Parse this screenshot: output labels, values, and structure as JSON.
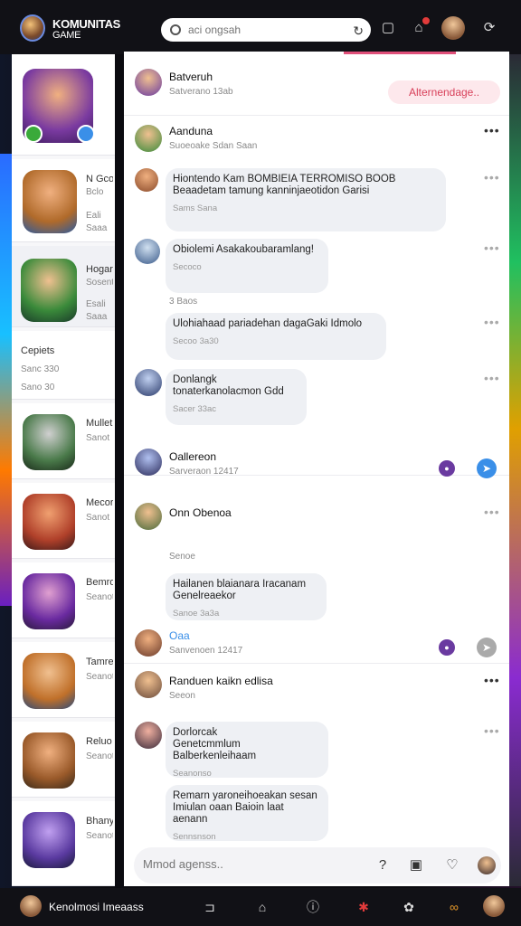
{
  "colors": {
    "accent": "#d8405a",
    "send_blue": "#3a8fe8",
    "badge": "#e23b3b"
  },
  "header": {
    "brand_title": "KOMUNITAS",
    "brand_subtitle": "GAME",
    "search_placeholder": "aci ongsah"
  },
  "left_cards": [
    {
      "name": "",
      "meta": ""
    },
    {
      "name": "N Gcoa",
      "meta": "Bclo",
      "stat1": "Eali",
      "stat2": "Saaa"
    },
    {
      "name": "Hogar",
      "meta": "Sosent",
      "stat1": "Esali",
      "stat2": "Saaa"
    },
    {
      "name": "Cepiets",
      "meta": "",
      "stat1": "Sanc 330",
      "stat2": "Sano 30"
    },
    {
      "name": "Mullet",
      "meta": "Sanot"
    },
    {
      "name": "Mecor",
      "meta": "Sanot"
    },
    {
      "name": "Bemro",
      "meta": "Seanot"
    },
    {
      "name": "Tamre",
      "meta": "Seanot"
    },
    {
      "name": "Reluo",
      "meta": "Seanot"
    },
    {
      "name": "Bhanyo",
      "meta": "Seanot"
    }
  ],
  "posts": [
    {
      "name": "Batveruh",
      "meta": "Satverano 13ab",
      "cta": "Alternendage.."
    },
    {
      "name": "Aanduna",
      "meta": "Suoeoake  Sdan  Saan",
      "text": "Hiontendo Kam BOMBIEIA TERROMISO BOOB Beaadetam tamung kanninjaeotidon Garisi",
      "time": "Sams  Sana"
    },
    {
      "name": "Obiolemi Asakakoubaramlang!",
      "meta": "Secoco",
      "reaction": "3 Baos",
      "reply": "Ulohiahaad pariadehan dagaGaki Idmolo",
      "reply_time": "Secoo  3a30"
    },
    {
      "name": "Donlangk",
      "text": "tonaterkanolacmon Gdd",
      "time": "Sacer  33ac"
    },
    {
      "name": "Oallereon",
      "meta": "Sarveraon  12417"
    }
  ],
  "thread2": [
    {
      "name": "Onn Obenoa",
      "meta": "Senoe"
    },
    {
      "reply": "Hailanen blaianara Iracanam Genelreaekor",
      "time": "Sanoe  3a3a"
    },
    {
      "name": "Oaa",
      "meta": "Sanvenoen  12417"
    }
  ],
  "thread3": [
    {
      "name": "Randuen kaikn edlisa",
      "meta": "Seeon"
    },
    {
      "name": "Dorlorcak",
      "text": "Genetcmmlum Balberkenleihaam",
      "meta": "Seanonso"
    },
    {
      "reply": "Remarn yaroneihoeakan sesan Imiulan oaan Baioin laat aenann",
      "time": "Sennsnson"
    }
  ],
  "composer": {
    "placeholder": "Mmod agenss.."
  },
  "footer": {
    "user_label": "Kenolmosi Imeaass"
  }
}
